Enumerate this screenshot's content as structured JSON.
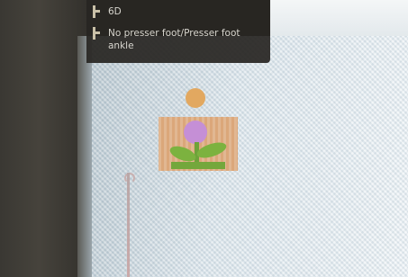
{
  "tooltip": {
    "items": [
      {
        "icon": "presser-foot-icon",
        "label": "6D"
      },
      {
        "icon": "presser-foot-icon",
        "label": "No presser foot/Presser foot ankle"
      }
    ]
  },
  "colors": {
    "panel": "#28261f",
    "motif_block": "#dba77a",
    "flower": "#c58fd6",
    "leaves": "#7cb23f",
    "sun": "#e2a860"
  }
}
